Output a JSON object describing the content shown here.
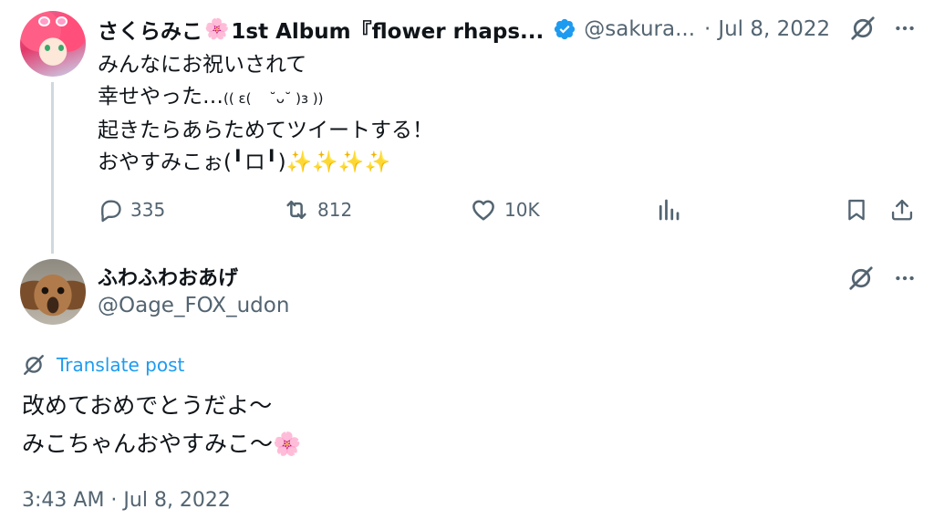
{
  "parent_tweet": {
    "author_name": "さくらみこ",
    "author_flower": "🌸",
    "author_album": "1st Album『flower rhaps...",
    "handle": "@sakura...",
    "separator": "·",
    "date": "Jul 8, 2022",
    "body_lines": [
      "みんなにお祝いされて",
      "幸せやった…",
      "起きたらあらためてツイートする！",
      "おやすみこぉ(╹ロ╹)✨✨✨✨"
    ],
    "body_line2_kaomoji": "(( ε(　 ˘ᴗ˘ )з ))",
    "actions": {
      "replies": "335",
      "retweets": "812",
      "likes": "10K"
    },
    "icons": {
      "verified": "verified-badge-icon",
      "grok": "grok-icon",
      "more": "more-icon",
      "reply": "reply-icon",
      "retweet": "retweet-icon",
      "like": "heart-icon",
      "views": "views-icon",
      "bookmark": "bookmark-icon",
      "share": "share-icon"
    }
  },
  "reply_tweet": {
    "author_name": "ふわふわおあげ",
    "handle": "@Oage_FOX_udon",
    "translate_label": "Translate post",
    "body_lines": [
      "改めておめでとうだよ〜",
      "みこちゃんおやすみこ〜🌸"
    ],
    "timestamp": "3:43 AM · Jul 8, 2022"
  },
  "colors": {
    "text_primary": "#0f1419",
    "text_secondary": "#536471",
    "accent": "#1d9bf0",
    "thread_line": "#cfd9de"
  }
}
